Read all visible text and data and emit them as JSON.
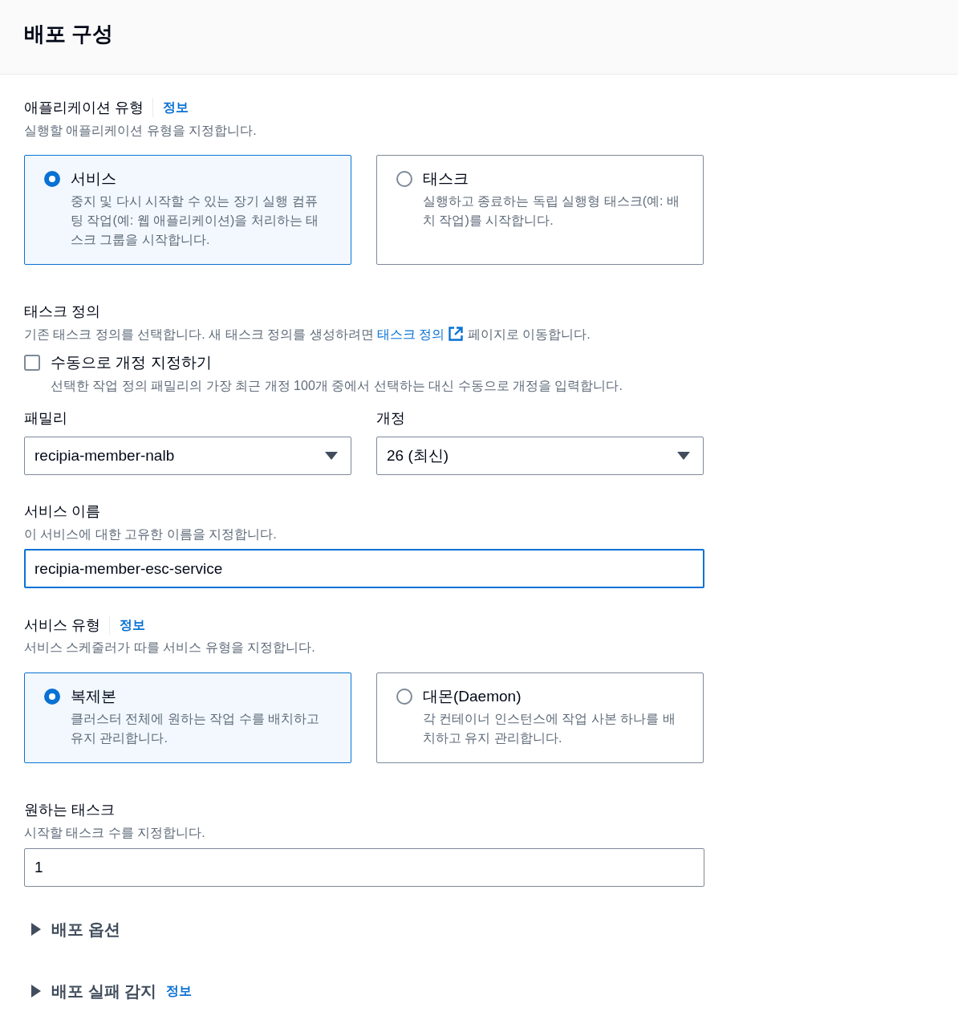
{
  "header": {
    "title": "배포 구성"
  },
  "application_type": {
    "label": "애플리케이션 유형",
    "info": "정보",
    "description": "실행할 애플리케이션 유형을 지정합니다.",
    "options": [
      {
        "title": "서비스",
        "description": "중지 및 다시 시작할 수 있는 장기 실행 컴퓨팅 작업(예: 웹 애플리케이션)을 처리하는 태스크 그룹을 시작합니다.",
        "selected": true
      },
      {
        "title": "태스크",
        "description": "실행하고 종료하는 독립 실행형 태스크(예: 배치 작업)를 시작합니다.",
        "selected": false
      }
    ]
  },
  "task_definition": {
    "label": "태스크 정의",
    "description": "기존 태스크 정의를 선택합니다. 새 태스크 정의를 생성하려면",
    "link": "태스크 정의",
    "description_end": "페이지로 이동합니다.",
    "manual_revision": {
      "label": "수동으로 개정 지정하기",
      "checked": false,
      "description": "선택한 작업 정의 패밀리의 가장 최근 개정 100개 중에서 선택하는 대신 수동으로 개정을 입력합니다."
    },
    "selects": [
      {
        "label": "패밀리",
        "value": "recipia-member-nalb"
      },
      {
        "label": "개정",
        "value": "26 (최신)"
      }
    ]
  },
  "service_name": {
    "label": "서비스 이름",
    "description": "이 서비스에 대한 고유한 이름을 지정합니다.",
    "value": "recipia-member-esc-service",
    "focused": true
  },
  "service_type": {
    "label": "서비스 유형",
    "info": "정보",
    "description": "서비스 스케줄러가 따를 서비스 유형을 지정합니다.",
    "options": [
      {
        "title": "복제본",
        "description": "클러스터 전체에 원하는 작업 수를 배치하고 유지 관리합니다.",
        "selected": true
      },
      {
        "title": "대몬(Daemon)",
        "description": "각 컨테이너 인스턴스에 작업 사본 하나를 배치하고 유지 관리합니다.",
        "selected": false
      }
    ]
  },
  "desired_tasks": {
    "label": "원하는 태스크",
    "description": "시작할 태스크 수를 지정합니다.",
    "value": "1",
    "focused": false
  },
  "sections": [
    {
      "title": "배포 옵션",
      "expanded": false
    },
    {
      "title": "배포 실패 감지",
      "info": "정보",
      "expanded": false
    }
  ]
}
